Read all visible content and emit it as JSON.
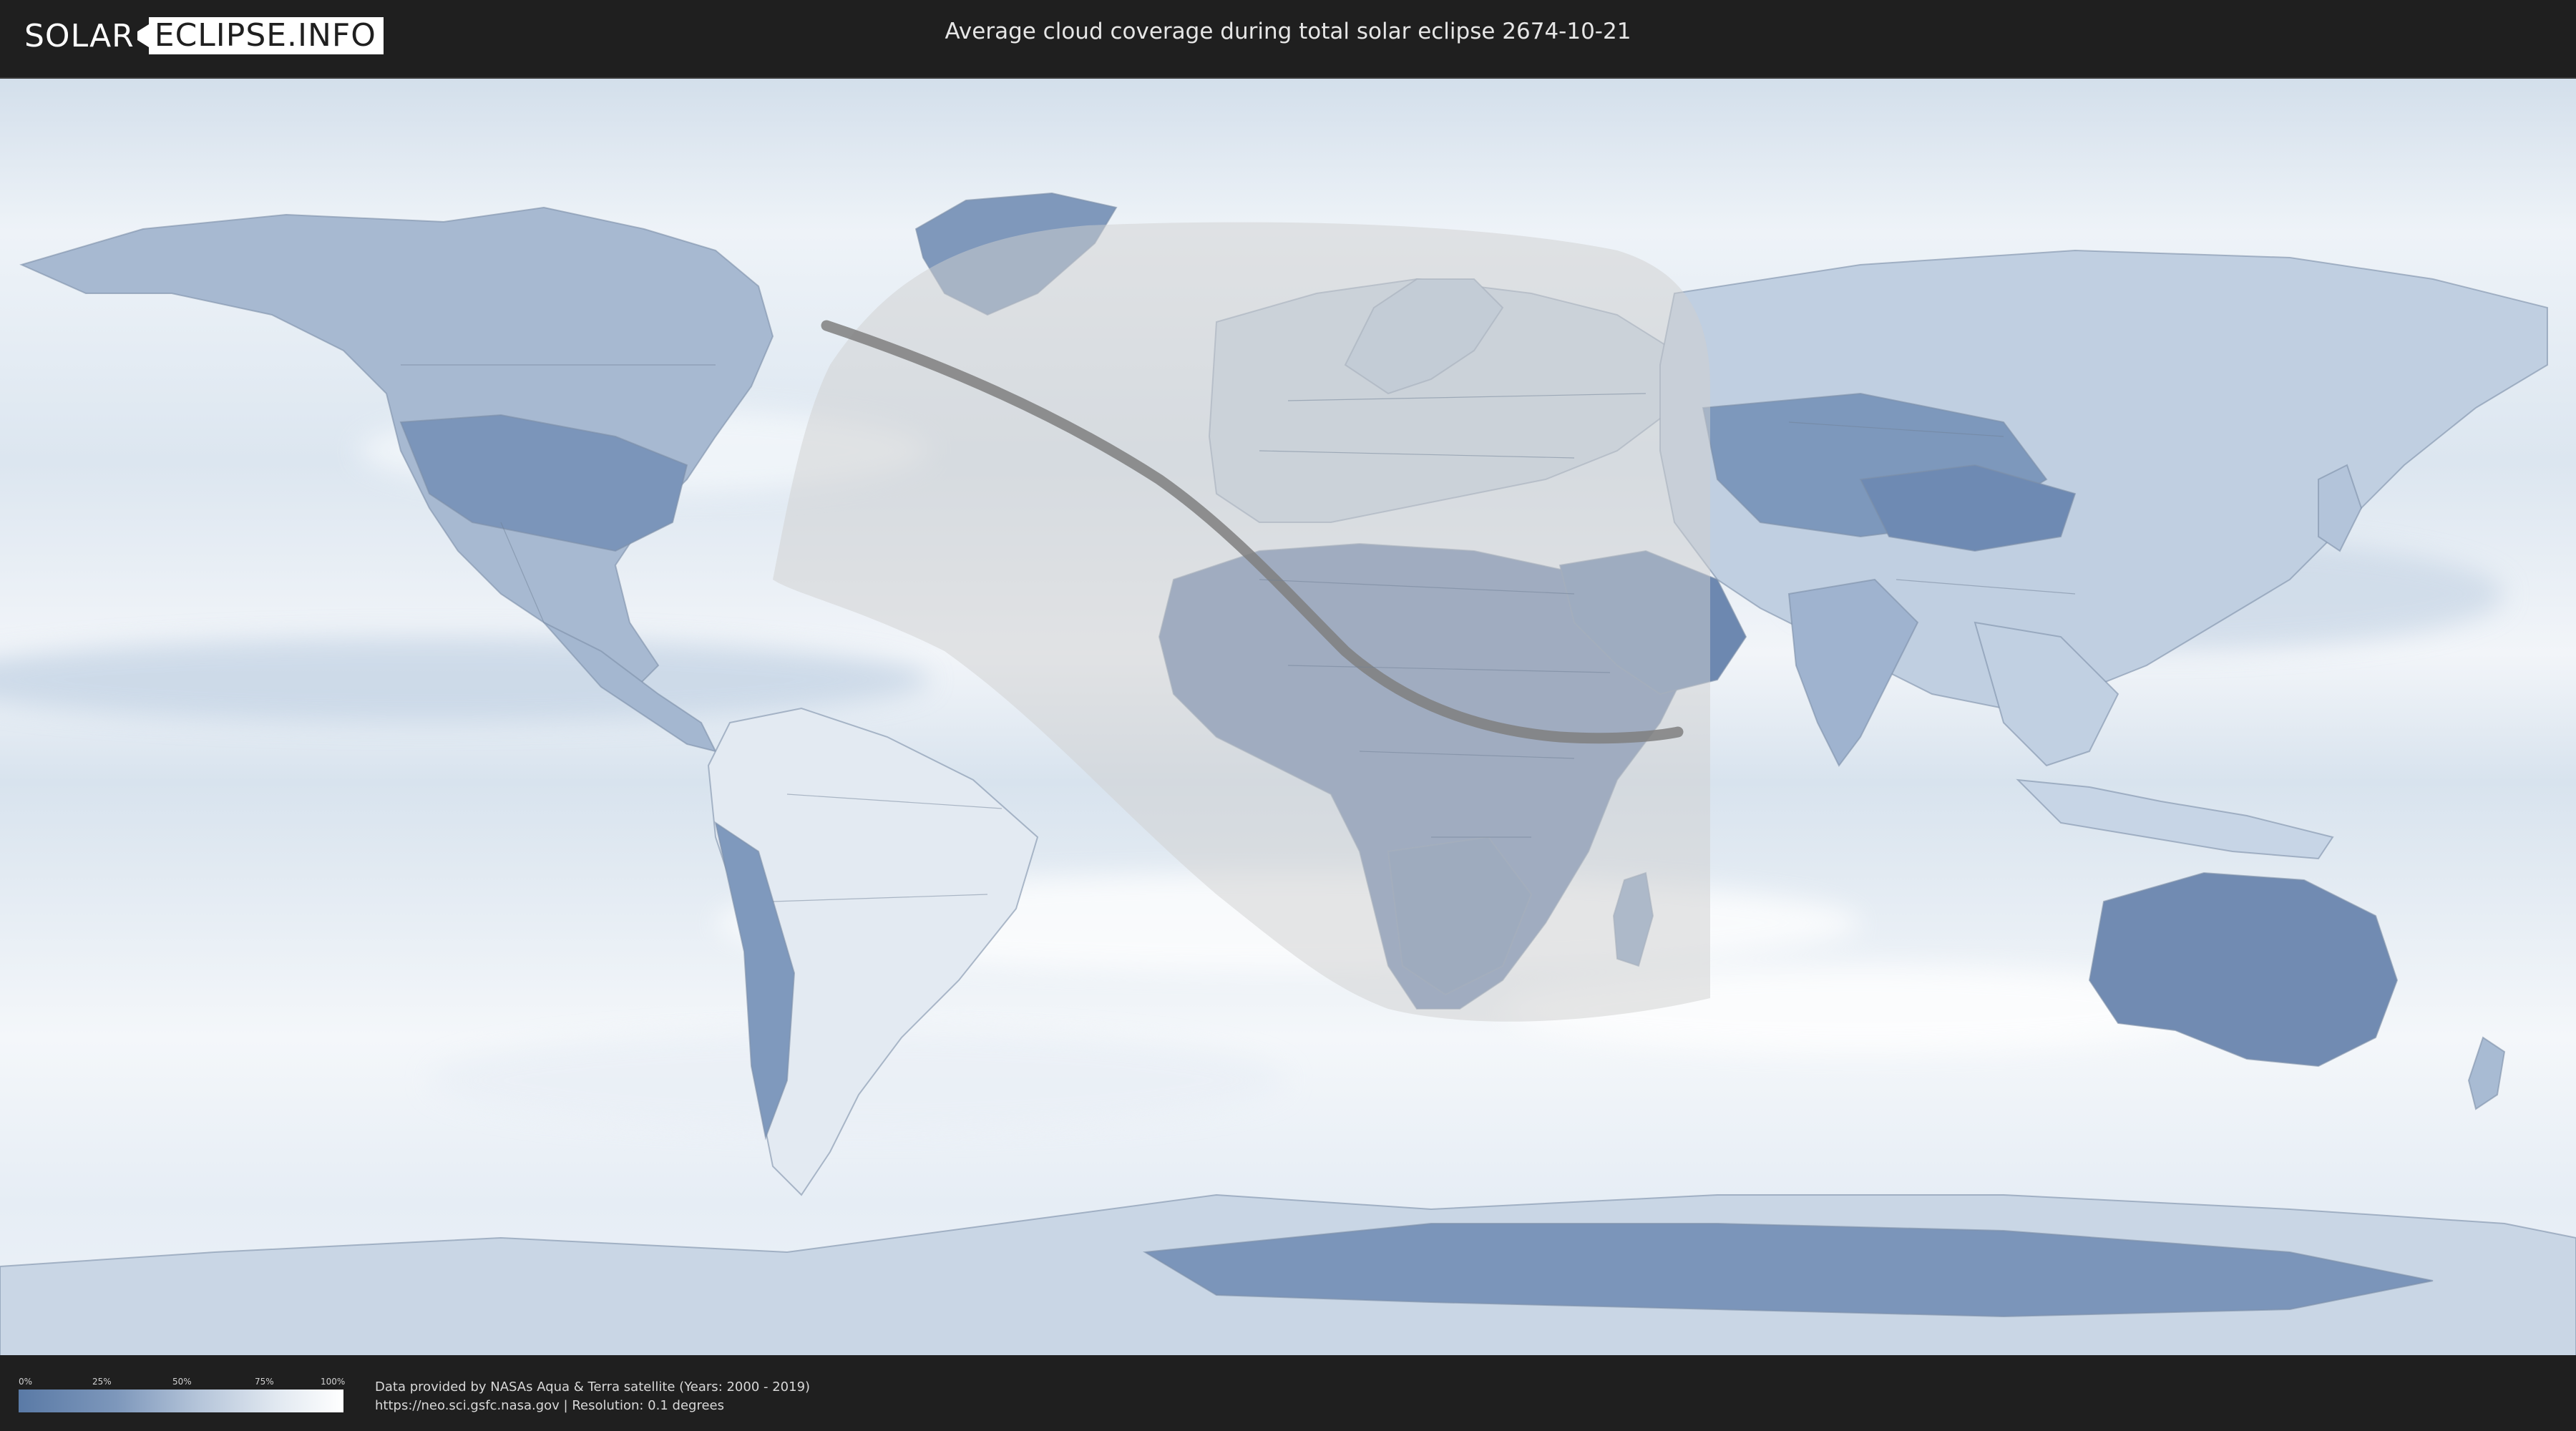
{
  "header": {
    "logo_left": "SOLAR",
    "logo_right": "ECLIPSE.INFO",
    "title": "Average cloud coverage during total solar eclipse 2674-10-21"
  },
  "legend": {
    "ticks": [
      "0%",
      "25%",
      "50%",
      "75%",
      "100%"
    ],
    "colors": {
      "low": "#5a7aa6",
      "high": "#ffffff"
    }
  },
  "credits": {
    "line1": "Data provided by NASAs Aqua & Terra satellite (Years: 2000 - 2019)",
    "line2": "https://neo.sci.gsfc.nasa.gov | Resolution: 0.1 degrees"
  },
  "map": {
    "projection": "equirectangular",
    "layers": [
      "cloud-coverage",
      "country-borders",
      "penumbra-region",
      "totality-path"
    ],
    "colors": {
      "ocean_cloud": "#e9eff6",
      "land": "#8ea6c6",
      "dense_land": "#6f8bb3",
      "penumbra": "#cfcfcf",
      "totality_path": "#7f7f7f"
    }
  }
}
